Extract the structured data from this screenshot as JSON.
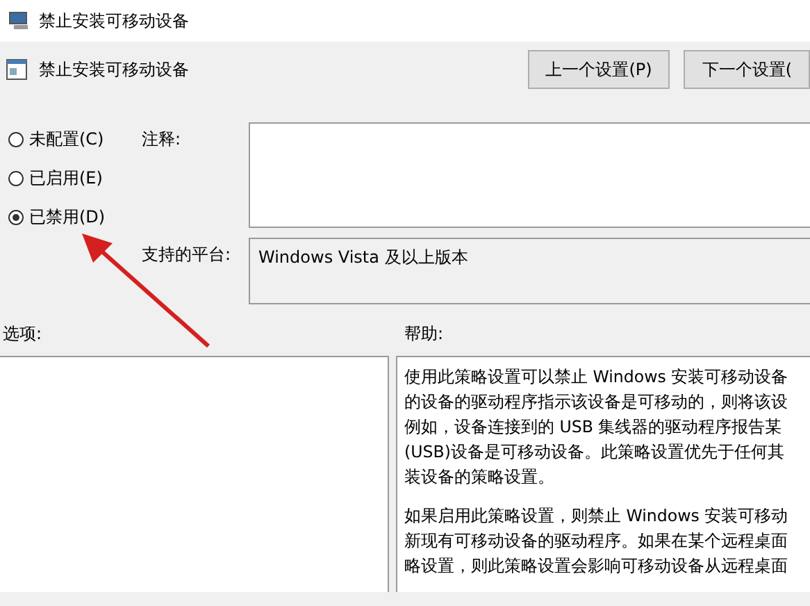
{
  "window": {
    "title": "禁止安装可移动设备"
  },
  "header": {
    "title": "禁止安装可移动设备",
    "buttons": [
      "上一个设置(P)",
      "下一个设置("
    ]
  },
  "states": [
    {
      "label": "未配置(C)",
      "selected": false
    },
    {
      "label": "已启用(E)",
      "selected": false
    },
    {
      "label": "已禁用(D)",
      "selected": true
    }
  ],
  "comment": {
    "label": "注释:"
  },
  "platform": {
    "label": "支持的平台:",
    "value": "Windows Vista 及以上版本"
  },
  "options": {
    "label": "选项:"
  },
  "help": {
    "label": "帮助:",
    "paragraphs": [
      [
        "使用此策略设置可以禁止 Windows 安装可移动设备",
        "的设备的驱动程序指示该设备是可移动的，则将该设",
        "例如，设备连接到的 USB 集线器的驱动程序报告某",
        "(USB)设备是可移动设备。此策略设置优先于任何其",
        "装设备的策略设置。"
      ],
      [
        "如果启用此策略设置，则禁止 Windows 安装可移动",
        "新现有可移动设备的驱动程序。如果在某个远程桌面",
        "略设置，则此策略设置会影响可移动设备从远程桌面"
      ]
    ]
  }
}
